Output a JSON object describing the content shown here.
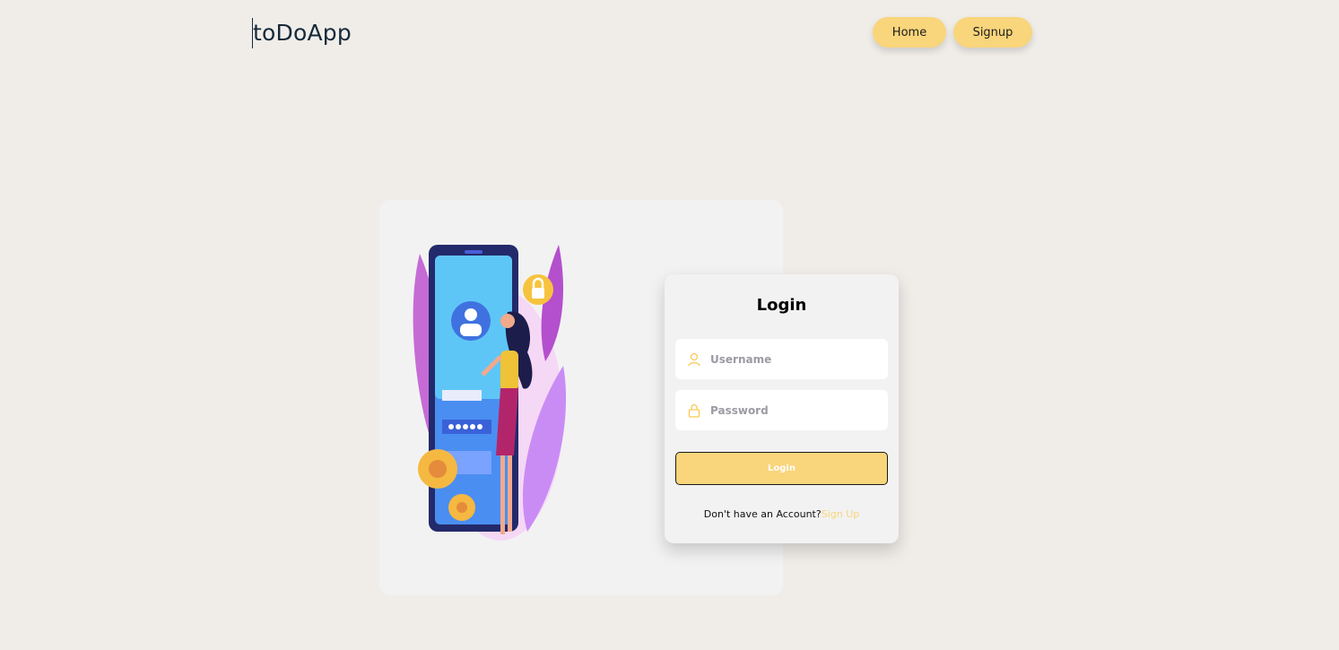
{
  "header": {
    "brand": "toDoApp",
    "nav": [
      {
        "label": "Home"
      },
      {
        "label": "Signup"
      }
    ]
  },
  "login": {
    "title": "Login",
    "username_placeholder": "Username",
    "password_placeholder": "Password",
    "submit_label": "Login",
    "no_account_text": "Don't have an Account?",
    "signup_link": "Sign Up"
  },
  "icons": {
    "username": "user-icon",
    "password": "lock-icon"
  },
  "colors": {
    "background": "#f0ede9",
    "accent": "#f9d57b",
    "brand_text": "#15293a",
    "card": "#f2f2f2"
  }
}
